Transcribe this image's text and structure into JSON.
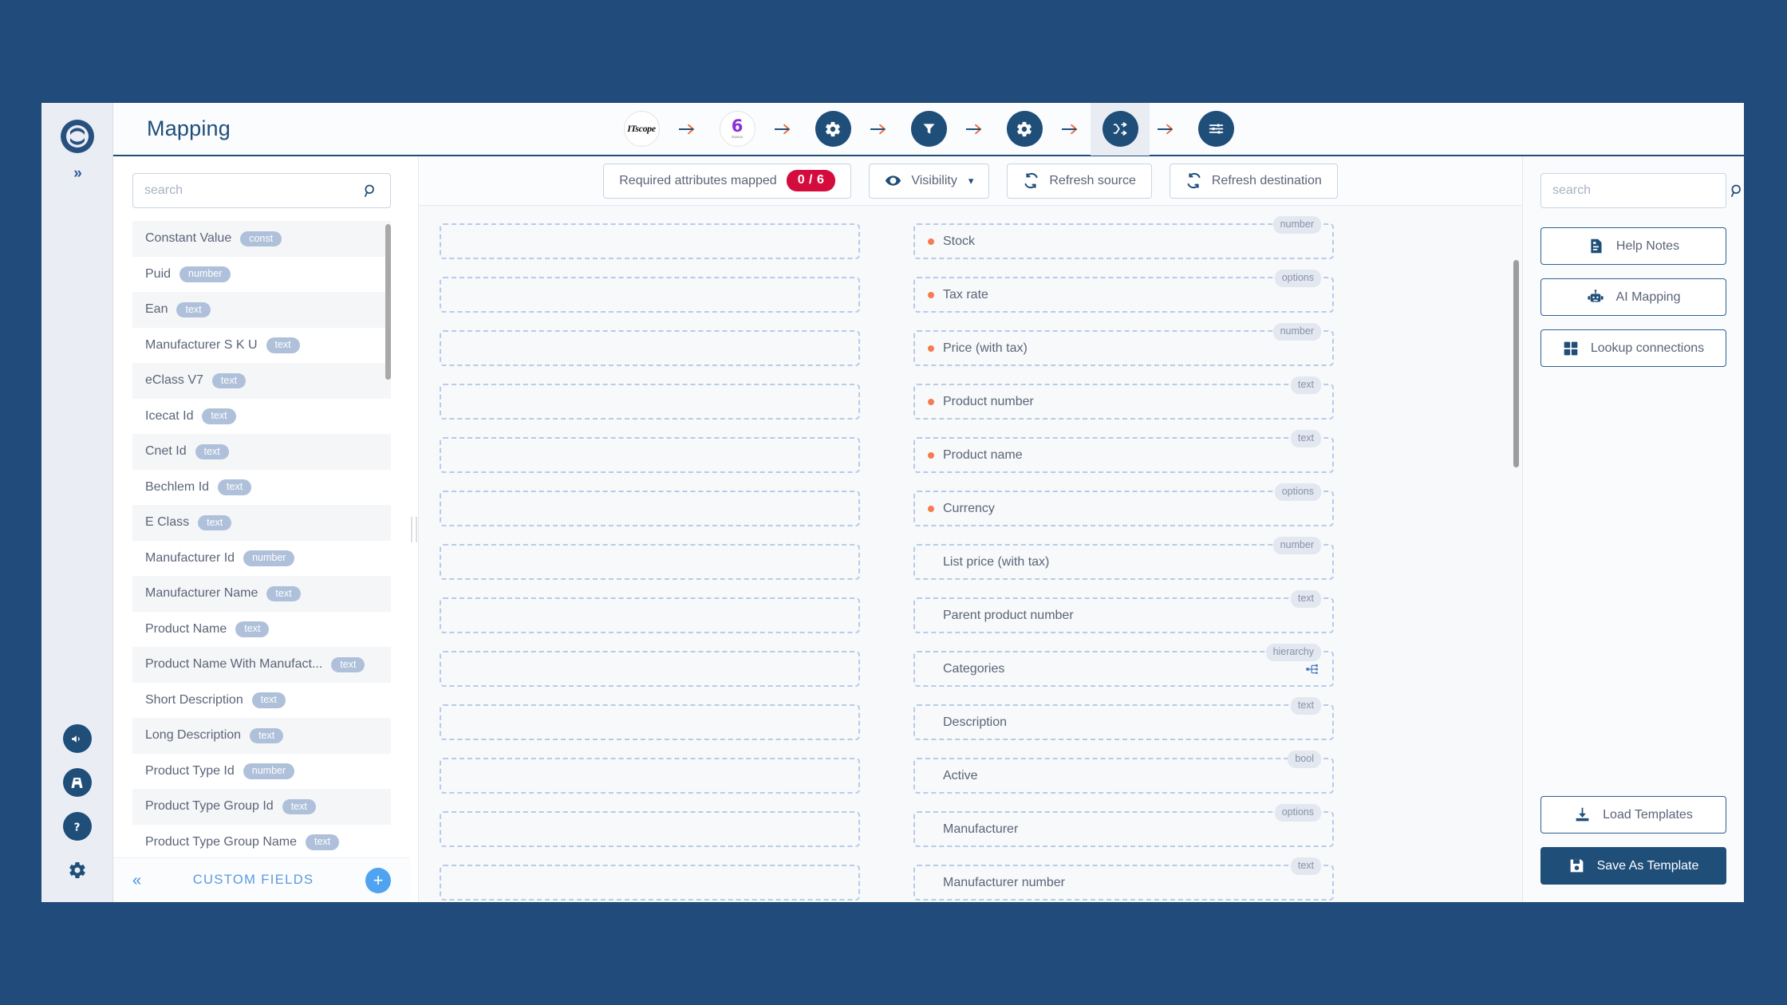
{
  "window": {
    "title": "Mapping",
    "accent": "#1f4e79",
    "page_bg": "#214b7b",
    "danger": "#d40b3d",
    "dot_color": "#f47c50"
  },
  "rail": {
    "logo_name": "app-logo",
    "expand_label": "»",
    "bottom_items": [
      {
        "name": "announcements-icon",
        "label": "Announcements"
      },
      {
        "name": "roadmap-icon",
        "label": "Roadmap"
      },
      {
        "name": "help-icon",
        "label": "Help"
      },
      {
        "name": "settings-icon",
        "label": "Settings"
      }
    ]
  },
  "pipeline": {
    "steps": [
      {
        "name": "step-itscope",
        "type": "logo-itscope",
        "label": "ITscope",
        "active": false
      },
      {
        "name": "step-six",
        "type": "logo-six",
        "label": "6",
        "sublabel": "impaxo",
        "active": false
      },
      {
        "name": "step-settings-1",
        "type": "gear",
        "label": "Settings",
        "active": false
      },
      {
        "name": "step-filter",
        "type": "filter",
        "label": "Filter",
        "active": false
      },
      {
        "name": "step-settings-2",
        "type": "gear",
        "label": "Settings",
        "active": false
      },
      {
        "name": "step-mapping",
        "type": "shuffle",
        "label": "Mapping",
        "active": true
      },
      {
        "name": "step-options",
        "type": "sliders",
        "label": "Options",
        "active": false
      }
    ]
  },
  "source_panel": {
    "search": {
      "value": "",
      "placeholder": "search"
    },
    "fields": [
      {
        "name": "Constant Value",
        "type": "const"
      },
      {
        "name": "Puid",
        "type": "number"
      },
      {
        "name": "Ean",
        "type": "text"
      },
      {
        "name": "Manufacturer S K U",
        "type": "text"
      },
      {
        "name": "eClass V7",
        "type": "text"
      },
      {
        "name": "Icecat Id",
        "type": "text"
      },
      {
        "name": "Cnet Id",
        "type": "text"
      },
      {
        "name": "Bechlem Id",
        "type": "text"
      },
      {
        "name": "E Class",
        "type": "text"
      },
      {
        "name": "Manufacturer Id",
        "type": "number"
      },
      {
        "name": "Manufacturer Name",
        "type": "text"
      },
      {
        "name": "Product Name",
        "type": "text"
      },
      {
        "name": "Product Name With Manufact...",
        "type": "text"
      },
      {
        "name": "Short Description",
        "type": "text"
      },
      {
        "name": "Long Description",
        "type": "text"
      },
      {
        "name": "Product Type Id",
        "type": "number"
      },
      {
        "name": "Product Type Group Id",
        "type": "text"
      },
      {
        "name": "Product Type Group Name",
        "type": "text"
      }
    ],
    "custom_fields": {
      "collapse_label": "«",
      "label": "CUSTOM FIELDS",
      "add_label": "+"
    }
  },
  "toolbar": {
    "required_label": "Required attributes mapped",
    "required_count": "0 / 6",
    "visibility_label": "Visibility",
    "visibility_caret": "❯",
    "refresh_source_label": "Refresh source",
    "refresh_destination_label": "Refresh destination"
  },
  "mapping": {
    "rows": [
      {
        "source": "",
        "destination": "Stock",
        "type": "number",
        "required": true
      },
      {
        "source": "",
        "destination": "Tax rate",
        "type": "options",
        "required": true
      },
      {
        "source": "",
        "destination": "Price (with tax)",
        "type": "number",
        "required": true
      },
      {
        "source": "",
        "destination": "Product number",
        "type": "text",
        "required": true
      },
      {
        "source": "",
        "destination": "Product name",
        "type": "text",
        "required": true
      },
      {
        "source": "",
        "destination": "Currency",
        "type": "options",
        "required": true
      },
      {
        "source": "",
        "destination": "List price (with tax)",
        "type": "number",
        "required": false
      },
      {
        "source": "",
        "destination": "Parent product number",
        "type": "text",
        "required": false
      },
      {
        "source": "",
        "destination": "Categories",
        "type": "hierarchy",
        "required": false,
        "icon": "hierarchy-icon"
      },
      {
        "source": "",
        "destination": "Description",
        "type": "text",
        "required": false
      },
      {
        "source": "",
        "destination": "Active",
        "type": "bool",
        "required": false
      },
      {
        "source": "",
        "destination": "Manufacturer",
        "type": "options",
        "required": false
      },
      {
        "source": "",
        "destination": "Manufacturer number",
        "type": "text",
        "required": false
      }
    ]
  },
  "right_panel": {
    "search": {
      "value": "",
      "placeholder": "search"
    },
    "buttons": [
      {
        "name": "help-notes-button",
        "label": "Help Notes",
        "icon": "notes-icon"
      },
      {
        "name": "ai-mapping-button",
        "label": "AI Mapping",
        "icon": "robot-icon"
      },
      {
        "name": "lookup-connections-button",
        "label": "Lookup connections",
        "icon": "grid-icon"
      }
    ],
    "load_templates_label": "Load Templates",
    "save_as_template_label": "Save As Template"
  }
}
